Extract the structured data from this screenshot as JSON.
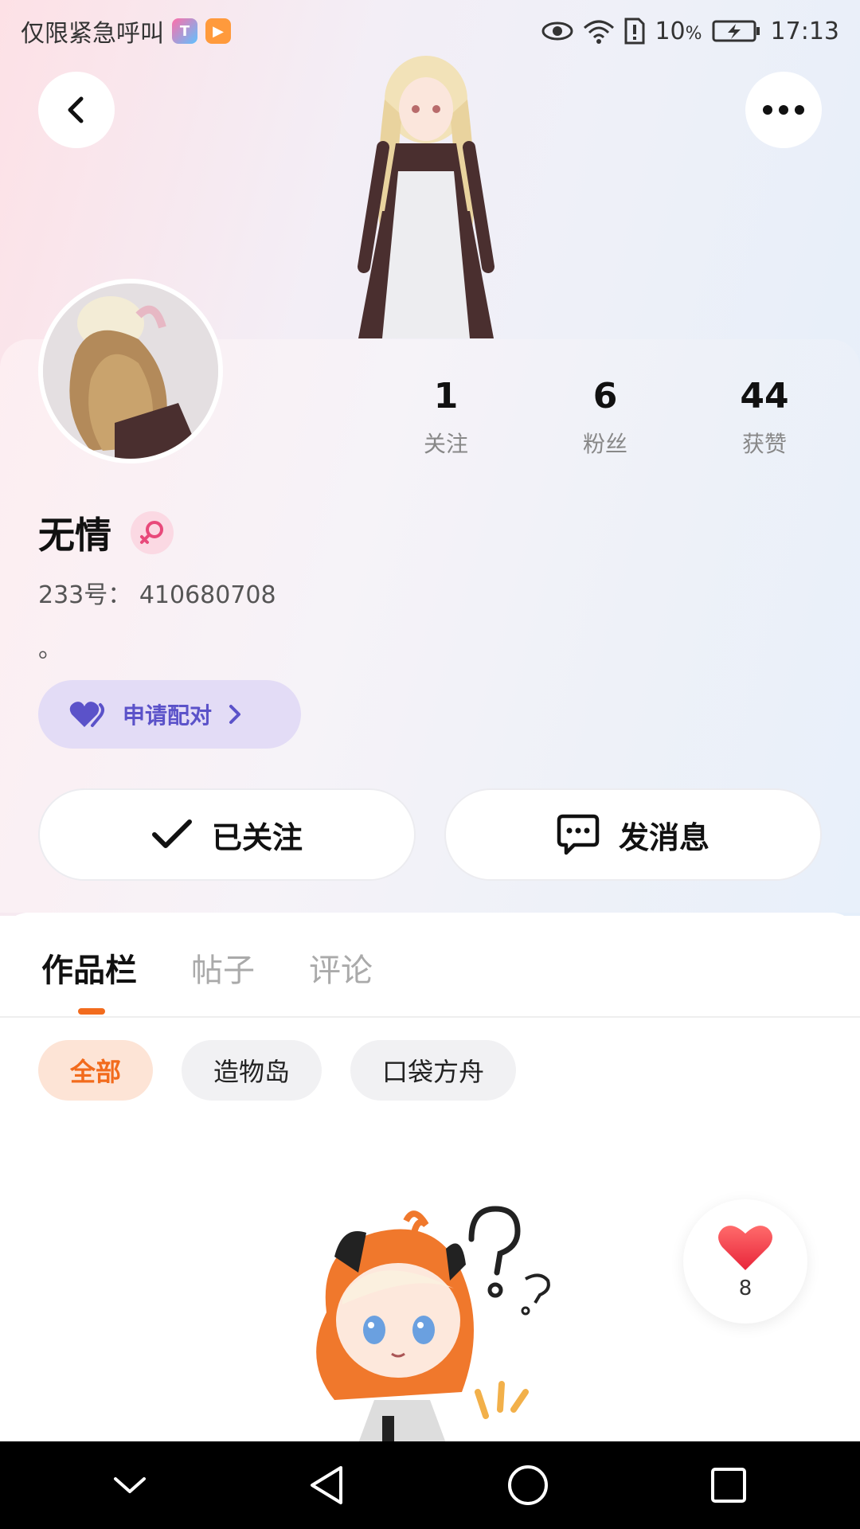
{
  "status_bar": {
    "carrier_text": "仅限紧急呼叫",
    "battery": "10",
    "battery_unit": "%",
    "time": "17:13"
  },
  "header": {
    "back_icon": "chevron-left-icon",
    "more_icon": "more-dots-icon"
  },
  "profile": {
    "name": "无情",
    "gender": "female",
    "uid_label": "233号：",
    "uid": "410680708",
    "bio": "。",
    "pair_label": "申请配对",
    "stats": [
      {
        "value": "1",
        "label": "关注"
      },
      {
        "value": "6",
        "label": "粉丝"
      },
      {
        "value": "44",
        "label": "获赞"
      }
    ]
  },
  "actions": {
    "follow_label": "已关注",
    "message_label": "发消息"
  },
  "tabs": {
    "items": [
      "作品栏",
      "帖子",
      "评论"
    ],
    "active_index": 0
  },
  "filters": {
    "items": [
      "全部",
      "造物岛",
      "口袋方舟"
    ],
    "active_index": 0
  },
  "like_fab": {
    "count": "8"
  },
  "colors": {
    "accent": "#f26b1d",
    "pair_text": "#5b52c9",
    "pair_bg": "#e3dcf6",
    "gender_pink": "#e8497a"
  }
}
